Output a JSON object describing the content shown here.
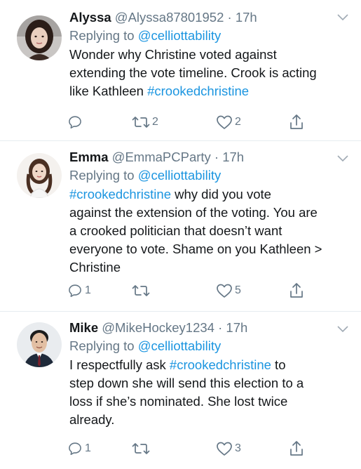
{
  "tweets": [
    {
      "display_name": "Alyssa",
      "handle": "@Alyssa87801952",
      "separator": "·",
      "time": "17h",
      "replying_prefix": "Replying to ",
      "replying_to": "@celliottability",
      "text_before": "Wonder why Christine voted against\nextending the vote timeline. Crook is acting\nlike Kathleen ",
      "hashtag": "#crookedchristine",
      "text_after": "",
      "reply_count": "",
      "retweet_count": "2",
      "like_count": "2",
      "avatar": "avatar-photo-woman"
    },
    {
      "display_name": "Emma",
      "handle": "@EmmaPCParty",
      "separator": "·",
      "time": "17h",
      "replying_prefix": "Replying to ",
      "replying_to": "@celliottability",
      "text_before": "",
      "hashtag": "#crookedchristine",
      "text_after": " why did you vote\nagainst the extension of the voting. You are\na crooked politician that doesn’t want\neveryone to vote. Shame on you Kathleen >\nChristine",
      "reply_count": "1",
      "retweet_count": "",
      "like_count": "5",
      "avatar": "avatar-photo-woman"
    },
    {
      "display_name": "Mike",
      "handle": "@MikeHockey1234",
      "separator": "·",
      "time": "17h",
      "replying_prefix": "Replying to ",
      "replying_to": "@celliottability",
      "text_before": "I respectfully ask ",
      "hashtag": "#crookedchristine",
      "text_after": " to\nstep down she will send this election to a\nloss if she’s nominated. She lost twice\nalready.",
      "reply_count": "1",
      "retweet_count": "",
      "like_count": "3",
      "avatar": "avatar-photo-man"
    }
  ],
  "colors": {
    "link": "#1b95e0",
    "muted": "#657786",
    "text": "#14171a",
    "divider": "#e6ecf0"
  },
  "icons": [
    "reply-icon",
    "retweet-icon",
    "like-icon",
    "share-icon",
    "chevron-down-icon"
  ]
}
